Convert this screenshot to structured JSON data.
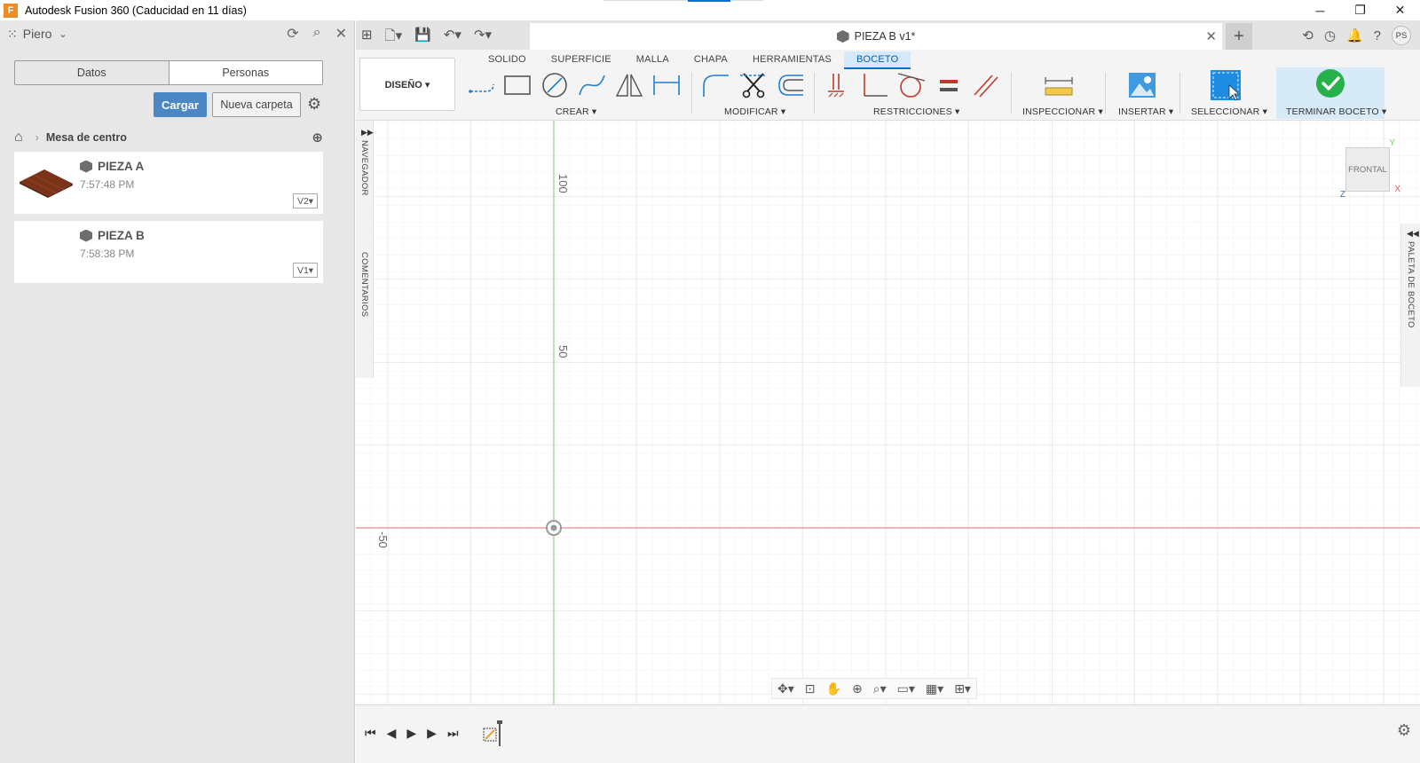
{
  "window": {
    "title": "Autodesk Fusion 360 (Caducidad en 11 días)",
    "app_icon_letter": "F",
    "minimize": "─",
    "maximize": "❐",
    "close": "✕"
  },
  "data_panel": {
    "user": "Piero",
    "tabs": [
      "Datos",
      "Personas"
    ],
    "upload_label": "Cargar",
    "new_folder_label": "Nueva carpeta",
    "breadcrumb": "Mesa de centro",
    "items": [
      {
        "name": "PIEZA A",
        "time": "7:57:48 PM",
        "version": "V2▾"
      },
      {
        "name": "PIEZA B",
        "time": "7:58:38 PM",
        "version": "V1▾"
      }
    ]
  },
  "document": {
    "tab_title": "PIEZA B v1*",
    "user_initials": "PS"
  },
  "ribbon": {
    "workspace": "DISEÑO ▾",
    "tabs": [
      "SOLIDO",
      "SUPERFICIE",
      "MALLA",
      "CHAPA",
      "HERRAMIENTAS",
      "BOCETO"
    ],
    "groups": {
      "create": "CREAR ▾",
      "modify": "MODIFICAR ▾",
      "constraints": "RESTRICCIONES ▾",
      "inspect": "INSPECCIONAR ▾",
      "insert": "INSERTAR ▾",
      "select": "SELECCIONAR ▾",
      "finish": "TERMINAR BOCETO ▾"
    }
  },
  "canvas": {
    "browser_label": "NAVEGADOR",
    "comments_label": "COMENTARIOS",
    "palette_label": "PALETA DE BOCETO",
    "axis_labels": [
      "100",
      "50",
      "-50"
    ],
    "viewcube_face": "FRONTAL",
    "axis_x": "X",
    "axis_y": "Y",
    "axis_z": "Z"
  },
  "colors": {
    "accent": "#0a6ed1",
    "x_axis": "#e05555",
    "y_axis": "#7ccf6a",
    "upload_button": "#4b87c5"
  }
}
